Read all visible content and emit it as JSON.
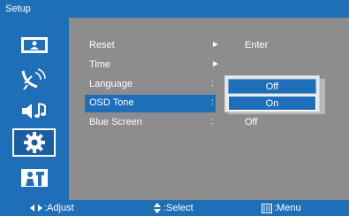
{
  "title": "Setup",
  "sidebar": {
    "items": [
      {
        "icon": "picture-icon"
      },
      {
        "icon": "antenna-icon"
      },
      {
        "icon": "audio-icon"
      },
      {
        "icon": "gear-icon",
        "selected": true
      },
      {
        "icon": "lock-icon"
      }
    ]
  },
  "menu": {
    "items": [
      {
        "label": "Reset",
        "glyph": "►",
        "value": "Enter"
      },
      {
        "label": "Time",
        "glyph": "►",
        "value": ""
      },
      {
        "label": "Language",
        "glyph": ":",
        "value": ""
      },
      {
        "label": "OSD Tone",
        "glyph": ":",
        "value": "",
        "active": true
      },
      {
        "label": "Blue Screen",
        "glyph": ":",
        "value": "Off"
      }
    ]
  },
  "popup": {
    "options": [
      "Off",
      "On"
    ],
    "selected": "On"
  },
  "footer": {
    "adjust": ":Adjust",
    "select": ":Select",
    "menu": ":Menu"
  },
  "colors": {
    "accent": "#1f6fb8",
    "panel": "#8d8d8d"
  }
}
